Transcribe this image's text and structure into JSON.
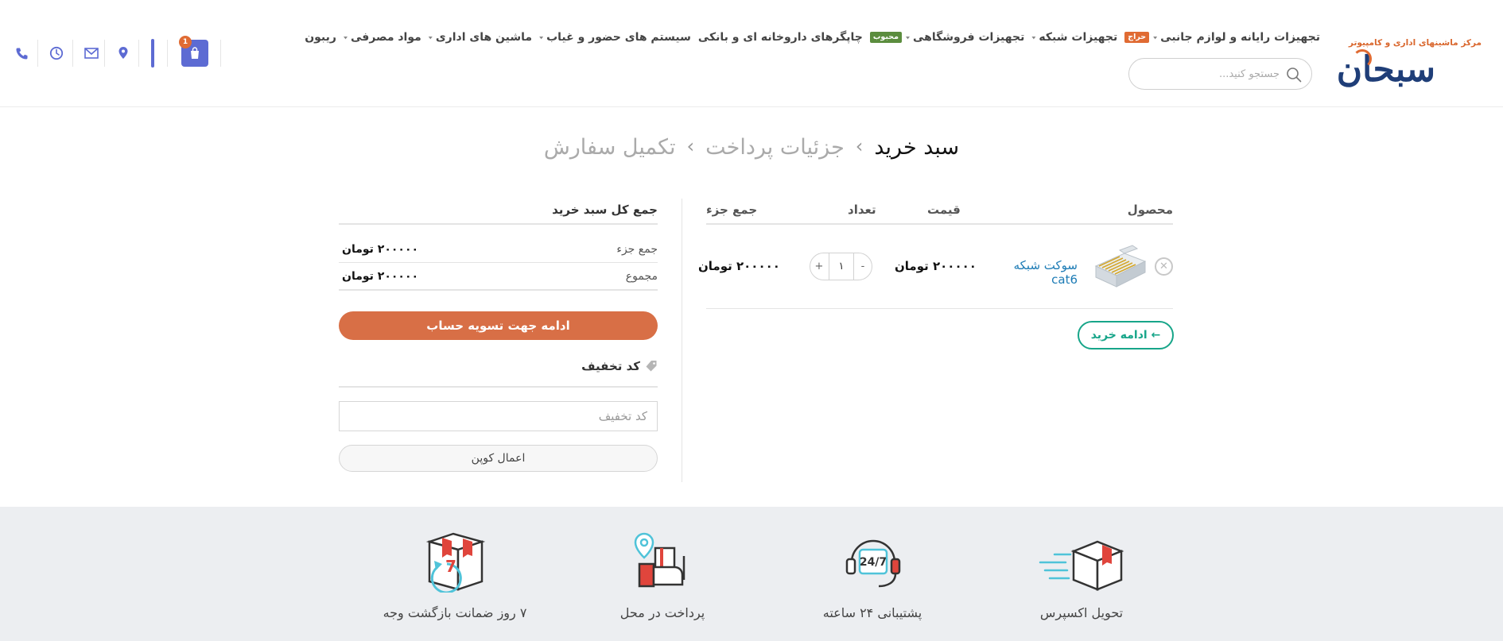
{
  "brand": {
    "name": "سبحان",
    "tagline": "مرکز ماشینهای اداری و کامپیوتر",
    "badge": "سبحان"
  },
  "nav": {
    "items": [
      {
        "label": "تجهیزات رایانه و لوازم جانبی",
        "has_dropdown": true,
        "badge": "حراج",
        "badge_color": "#e06b33"
      },
      {
        "label": "تجهیزات شبکه",
        "has_dropdown": true
      },
      {
        "label": "تجهیزات فروشگاهی",
        "has_dropdown": true,
        "badge": "محبوب",
        "badge_color": "#5b8d3e"
      },
      {
        "label": "چاپگرهای داروخانه ای و بانکی",
        "has_dropdown": false
      },
      {
        "label": "سیستم های حضور و غیاب",
        "has_dropdown": true
      },
      {
        "label": "ماشین های اداری",
        "has_dropdown": true
      },
      {
        "label": "مواد مصرفی",
        "has_dropdown": true
      },
      {
        "label": "ریبون",
        "has_dropdown": false
      }
    ]
  },
  "search": {
    "placeholder": "جستجو کنید..."
  },
  "header_icons": {
    "cart_count": "1",
    "icons": [
      "cart-icon",
      "location-icon",
      "mail-icon",
      "clock-icon",
      "phone-icon"
    ]
  },
  "breadcrumb": {
    "steps": [
      "سبد خرید",
      "جزئیات پرداخت",
      "تکمیل سفارش"
    ],
    "separator": "›"
  },
  "cart": {
    "columns": {
      "product": "محصول",
      "price": "قیمت",
      "quantity": "تعداد",
      "subtotal": "جمع جزء"
    },
    "items": [
      {
        "name": "سوکت شبکه cat6",
        "price": "۲۰۰۰۰۰ تومان",
        "quantity": "۱",
        "subtotal": "۲۰۰۰۰۰ تومان"
      }
    ],
    "continue_shopping": "← ادامه خرید"
  },
  "totals": {
    "title": "جمع کل سبد خرید",
    "rows": [
      {
        "label": "جمع جزء",
        "value": "۲۰۰۰۰۰ تومان"
      },
      {
        "label": "مجموع",
        "value": "۲۰۰۰۰۰ تومان"
      }
    ],
    "checkout_label": "ادامه جهت تسویه حساب",
    "coupon_title": "کد تخفیف",
    "coupon_placeholder": "کد تخفیف",
    "apply_label": "اعمال کوپن"
  },
  "features": [
    {
      "label": "تحویل اکسپرس",
      "icon": "express-delivery-icon"
    },
    {
      "label": "پشتیبانی ۲۴ ساعته",
      "icon": "support-24-7-icon"
    },
    {
      "label": "پرداخت در محل",
      "icon": "pay-on-delivery-icon"
    },
    {
      "label": "۷ روز ضمانت بازگشت وجه",
      "icon": "money-back-icon"
    }
  ],
  "colors": {
    "accent": "#5d6bd3",
    "checkout": "#d86f46",
    "continue": "#17a589",
    "link": "#1c7bb5",
    "footer_bg": "#eceef1"
  }
}
